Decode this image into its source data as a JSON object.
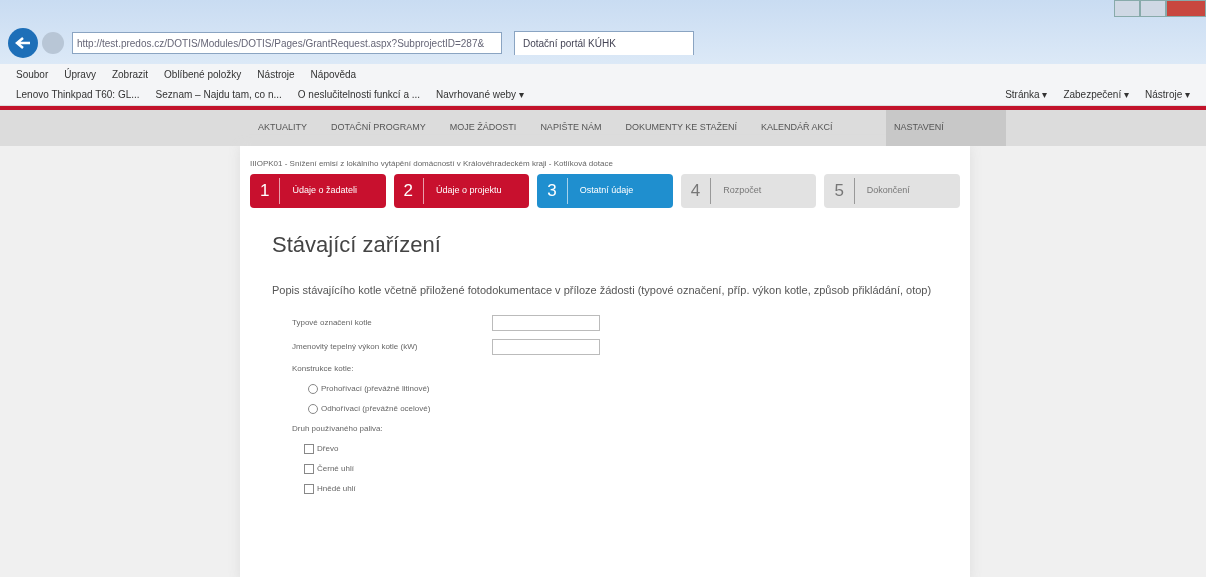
{
  "browser": {
    "url": "http://test.predos.cz/DOTIS/Modules/DOTIS/Pages/GrantRequest.aspx?SubprojectID=287&",
    "tabs": [
      {
        "label": "Dotační portál KÚHK",
        "selected": true
      }
    ],
    "menu": [
      "Soubor",
      "Úpravy",
      "Zobrazit",
      "Oblíbené položky",
      "Nástroje",
      "Nápověda"
    ],
    "favorites": [
      "Lenovo Thinkpad T60: GL...",
      "Seznam – Najdu tam, co n...",
      "O neslučitelnosti funkcí a ...",
      "Navrhované weby ▾"
    ],
    "commands": [
      "Stránka ▾",
      "Zabezpečení ▾",
      "Nástroje ▾"
    ]
  },
  "nav": [
    {
      "label": "AKTUALITY"
    },
    {
      "label": "DOTAČNÍ PROGRAMY"
    },
    {
      "label": "MOJE ŽÁDOSTI"
    },
    {
      "label": "NAPIŠTE NÁM"
    },
    {
      "label": "DOKUMENTY KE STAŽENÍ"
    },
    {
      "label": "KALENDÁŘ AKCÍ"
    }
  ],
  "nav_right": "NASTAVENÍ",
  "breadcrumb": "IIIOPK01 - Snížení emisí z lokálního vytápění domácností v Královéhradeckém kraji - Kotlíková dotace",
  "steps": [
    {
      "number": "1",
      "label": "Údaje o žadateli",
      "completed": true,
      "selected": false
    },
    {
      "number": "2",
      "label": "Údaje o projektu",
      "completed": true,
      "selected": false
    },
    {
      "number": "3",
      "label": "Ostatní údaje",
      "completed": false,
      "selected": true
    },
    {
      "number": "4",
      "label": "Rozpočet",
      "completed": false,
      "selected": false
    },
    {
      "number": "5",
      "label": "Dokončení",
      "completed": false,
      "selected": false
    }
  ],
  "heading": "Stávající zařízení",
  "description": "Popis stávajícího kotle včetně přiložené fotodokumentace v příloze žádosti (typové označení, příp. výkon kotle, způsob přikládání, otop)",
  "form": [
    {
      "kind": "text",
      "label": "Typové označení kotle"
    },
    {
      "kind": "text",
      "label": "Jmenovitý tepelný výkon kotle (kW)"
    },
    {
      "kind": "radio",
      "label": "Konstrukce kotle:",
      "options": [
        {
          "label": "Prohořívací (převážně litinové)",
          "checked": false
        },
        {
          "label": "Odhořívací (převážně ocelové)",
          "checked": false
        }
      ]
    },
    {
      "kind": "checkbox",
      "label": "Druh používaného paliva:",
      "options": [
        {
          "label": "Dřevo",
          "checked": false
        },
        {
          "label": "Černé uhlí",
          "checked": false
        },
        {
          "label": "Hnědé uhlí",
          "checked": false
        }
      ]
    }
  ]
}
